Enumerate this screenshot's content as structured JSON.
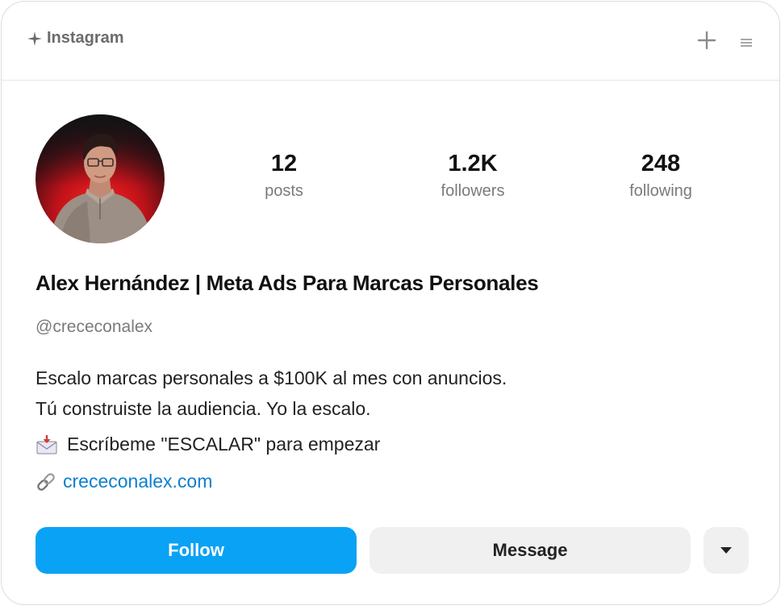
{
  "header": {
    "brand_label": "Instagram",
    "brand_icon": "sparkle-icon",
    "plus_icon": "plus-icon",
    "menu_icon": "menu-icon"
  },
  "profile": {
    "avatar_icon": "profile-photo",
    "stats": [
      {
        "value": "12",
        "label": "posts"
      },
      {
        "value": "1.2K",
        "label": "followers"
      },
      {
        "value": "248",
        "label": "following"
      }
    ],
    "name": "Alex Hernández | Meta Ads Para Marcas Personales",
    "handle": "@crececonalex",
    "bio_lines": [
      "Escalo marcas personales a $100K al mes con anuncios.",
      "Tú construiste la audiencia. Yo la escalo."
    ],
    "cta_icon": "envelope-arrow-icon",
    "cta": "Escríbeme \"ESCALAR\" para empezar",
    "link_icon": "link-icon",
    "link": "crececonalex.com"
  },
  "actions": {
    "follow_label": "Follow",
    "message_label": "Message",
    "more_icon": "caret-down-icon"
  },
  "colors": {
    "accent": "#0aa2f5",
    "link": "#0a7fcf",
    "muted": "#7a7a7a",
    "button_secondary": "#f0f0f0"
  }
}
